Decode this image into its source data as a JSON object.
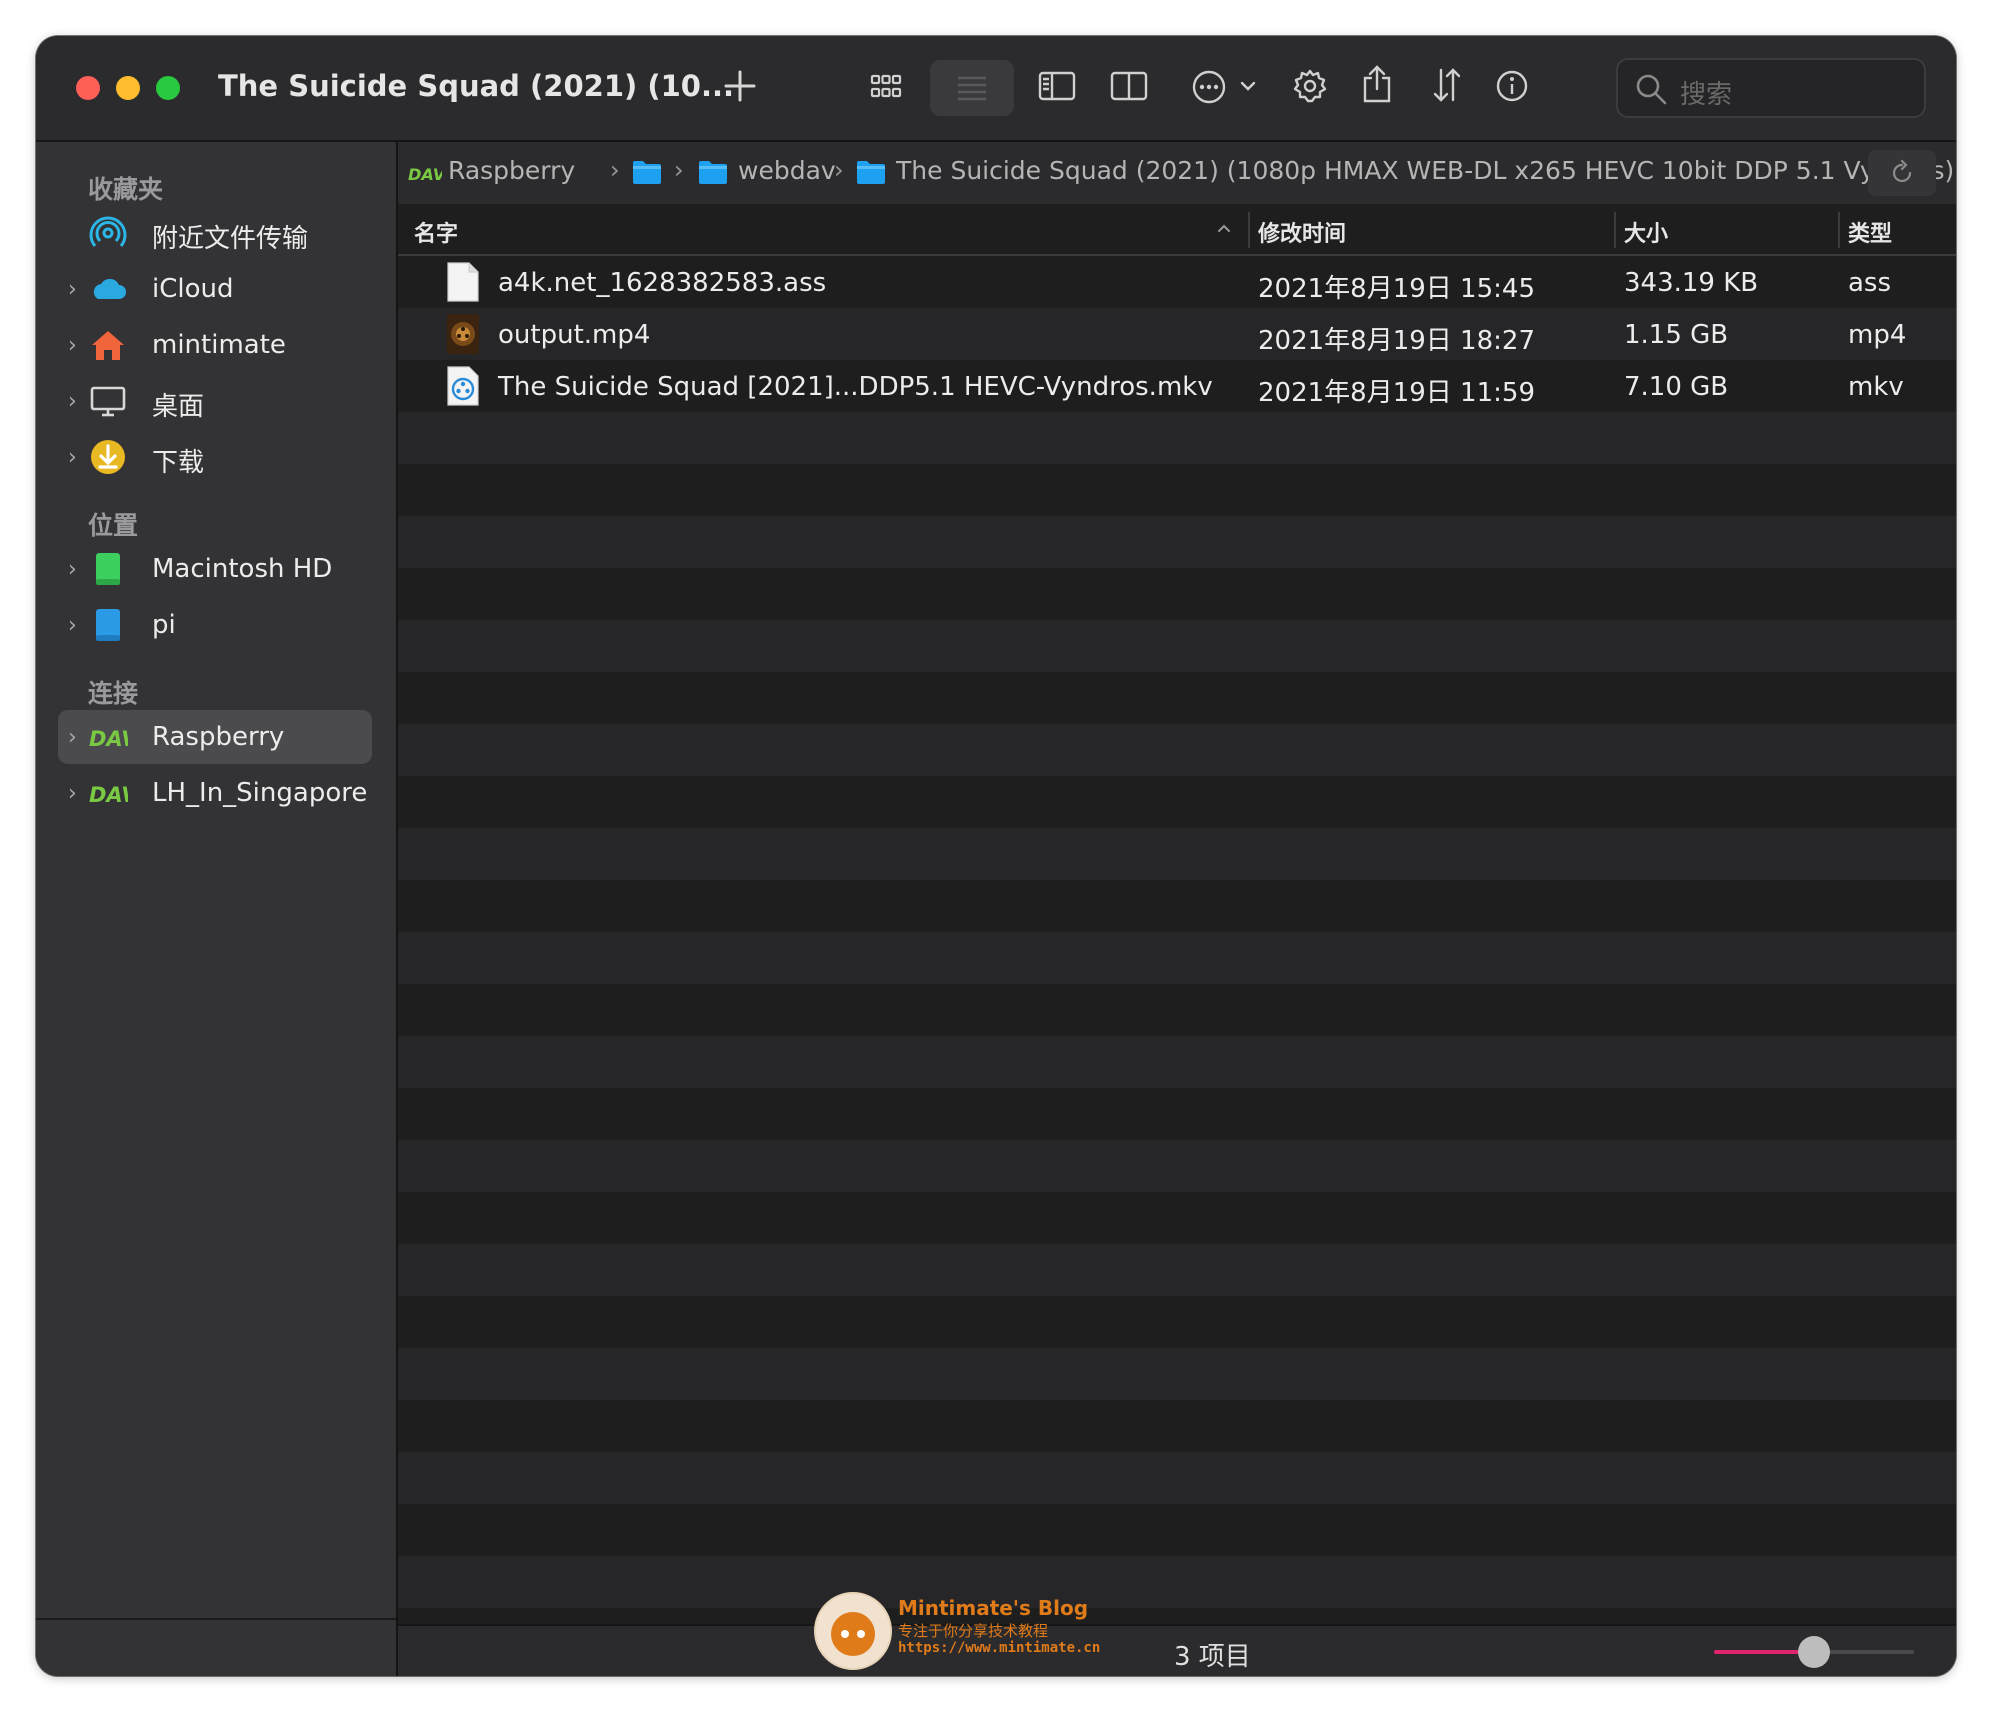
{
  "window": {
    "title": "The Suicide Squad (2021) (10...",
    "search_placeholder": "搜索"
  },
  "sidebar": {
    "sections": [
      {
        "label": "收藏夹"
      },
      {
        "label": "位置"
      },
      {
        "label": "连接"
      }
    ],
    "items": [
      {
        "label": "附近文件传输",
        "icon": "airdrop-icon"
      },
      {
        "label": "iCloud",
        "icon": "icloud-icon"
      },
      {
        "label": "mintimate",
        "icon": "home-icon"
      },
      {
        "label": "桌面",
        "icon": "desktop-icon"
      },
      {
        "label": "下载",
        "icon": "download-icon"
      },
      {
        "label": "Macintosh HD",
        "icon": "drive-icon"
      },
      {
        "label": "pi",
        "icon": "drive-icon"
      },
      {
        "label": "Raspberry",
        "icon": "dav-icon",
        "selected": true
      },
      {
        "label": "LH_In_Singapore",
        "icon": "dav-icon"
      }
    ]
  },
  "pathbar": {
    "crumbs": [
      "Raspberry",
      "webdav",
      "The Suicide Squad (2021) (1080p HMAX WEB-DL x265 HEVC 10bit DDP 5.1 Vyndros)"
    ]
  },
  "columns": {
    "name": "名字",
    "modified": "修改时间",
    "size": "大小",
    "kind": "类型"
  },
  "files": [
    {
      "name": "a4k.net_1628382583.ass",
      "modified": "2021年8月19日 15:45",
      "size": "343.19 KB",
      "kind": "ass",
      "icon": "document-icon"
    },
    {
      "name": "output.mp4",
      "modified": "2021年8月19日 18:27",
      "size": "1.15 GB",
      "kind": "mp4",
      "icon": "video-thumbnail-icon"
    },
    {
      "name": "The Suicide Squad [2021]...DDP5.1 HEVC-Vyndros.mkv",
      "modified": "2021年8月19日 11:59",
      "size": "7.10 GB",
      "kind": "mkv",
      "icon": "film-reel-icon"
    }
  ],
  "status": {
    "item_count": "3 项目",
    "icon_size_fraction": 0.5
  },
  "watermark": {
    "title": "Mintimate's Blog",
    "subtitle": "专注于你分享技术教程",
    "url": "https://www.mintimate.cn"
  },
  "colors": {
    "accent_slider": "#e0246e",
    "dav_green": "#7ac943",
    "folder_blue": "#1ea1f1"
  }
}
